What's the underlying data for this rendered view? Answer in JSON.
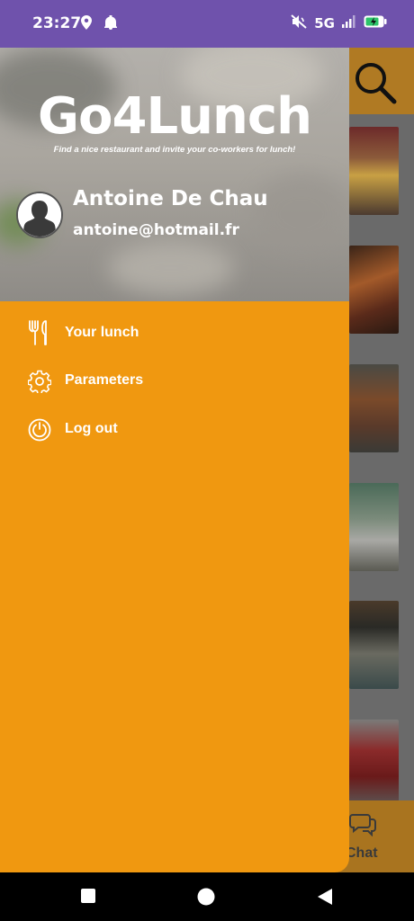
{
  "status_bar": {
    "time": "23:27",
    "network": "5G",
    "icons": [
      "location-icon",
      "notification-bell-icon",
      "mute-icon",
      "signal-icon",
      "battery-charging-icon"
    ]
  },
  "background_app": {
    "search_icon": "search-icon",
    "bottom_nav": {
      "chat_label": "Chat",
      "chat_icon": "chat-icon"
    }
  },
  "drawer": {
    "app_title": "Go4Lunch",
    "tagline": "Find a nice restaurant and invite your co-workers for lunch!",
    "user": {
      "name": "Antoine De Chau",
      "email": "antoine@hotmail.fr",
      "avatar_icon": "person-silhouette-icon"
    },
    "menu": [
      {
        "label": "Your lunch",
        "icon": "fork-knife-icon"
      },
      {
        "label": "Parameters",
        "icon": "gear-icon"
      },
      {
        "label": "Log out",
        "icon": "power-icon"
      }
    ],
    "colors": {
      "drawer_bg": "#f09810",
      "status_bar": "#6f52ac",
      "text": "#ffffff"
    }
  },
  "system_nav": {
    "buttons": [
      "recents-button",
      "home-button",
      "back-button"
    ]
  }
}
